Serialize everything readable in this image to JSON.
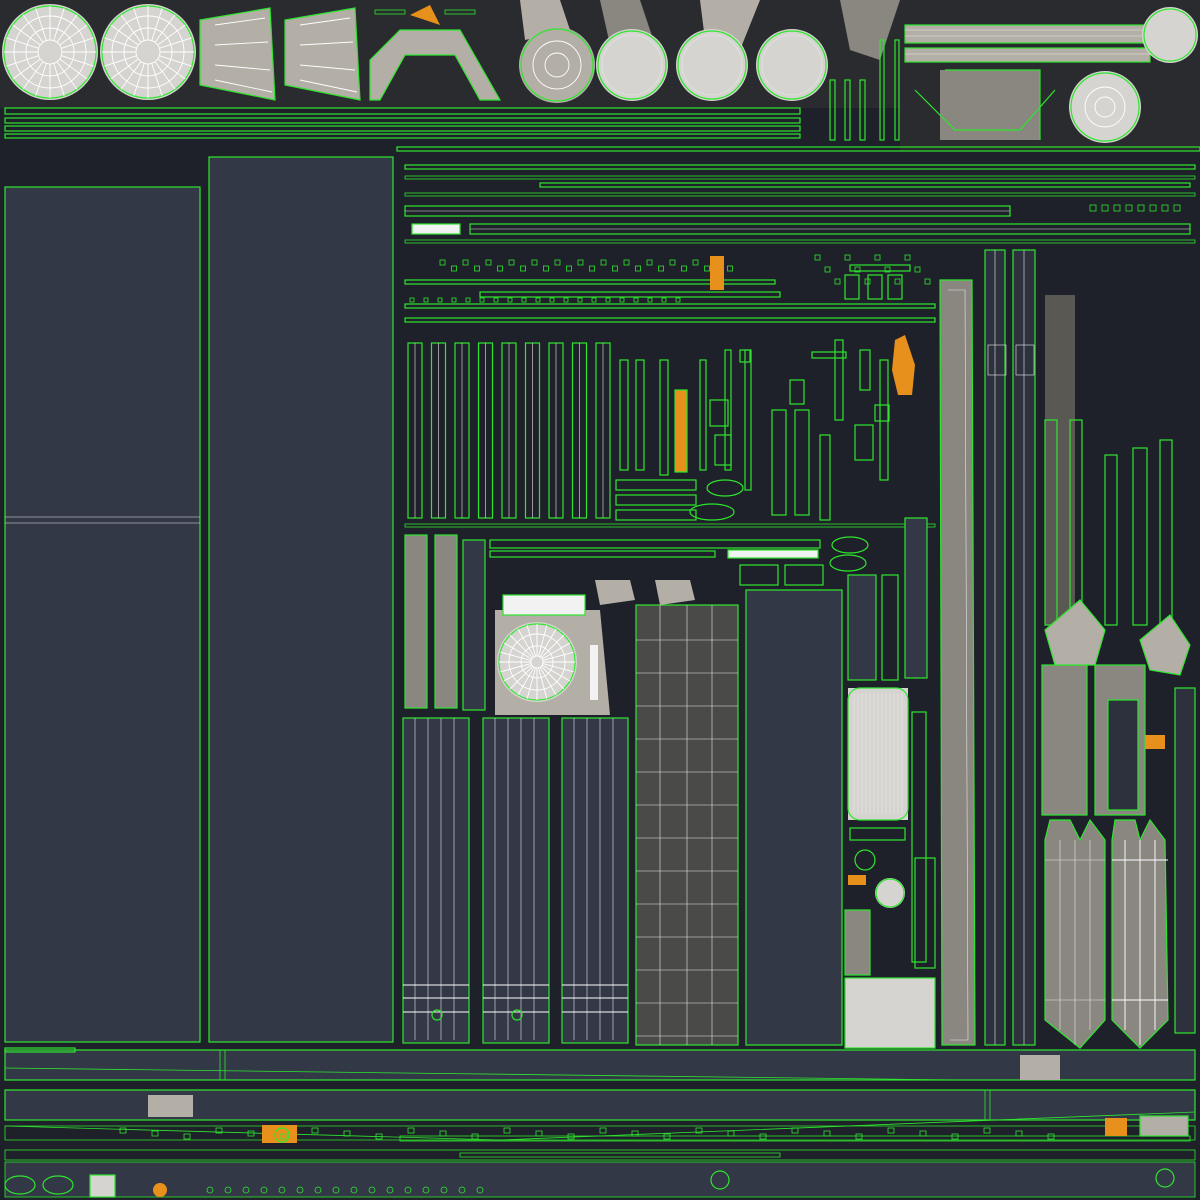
{
  "texture": {
    "background": "#1c1f26",
    "panel": "#323846",
    "uv_outline": "#2ee62e",
    "wireframe": "#ffffff",
    "highlight": "#e8901c",
    "shaded_gray": "#8a8680"
  }
}
